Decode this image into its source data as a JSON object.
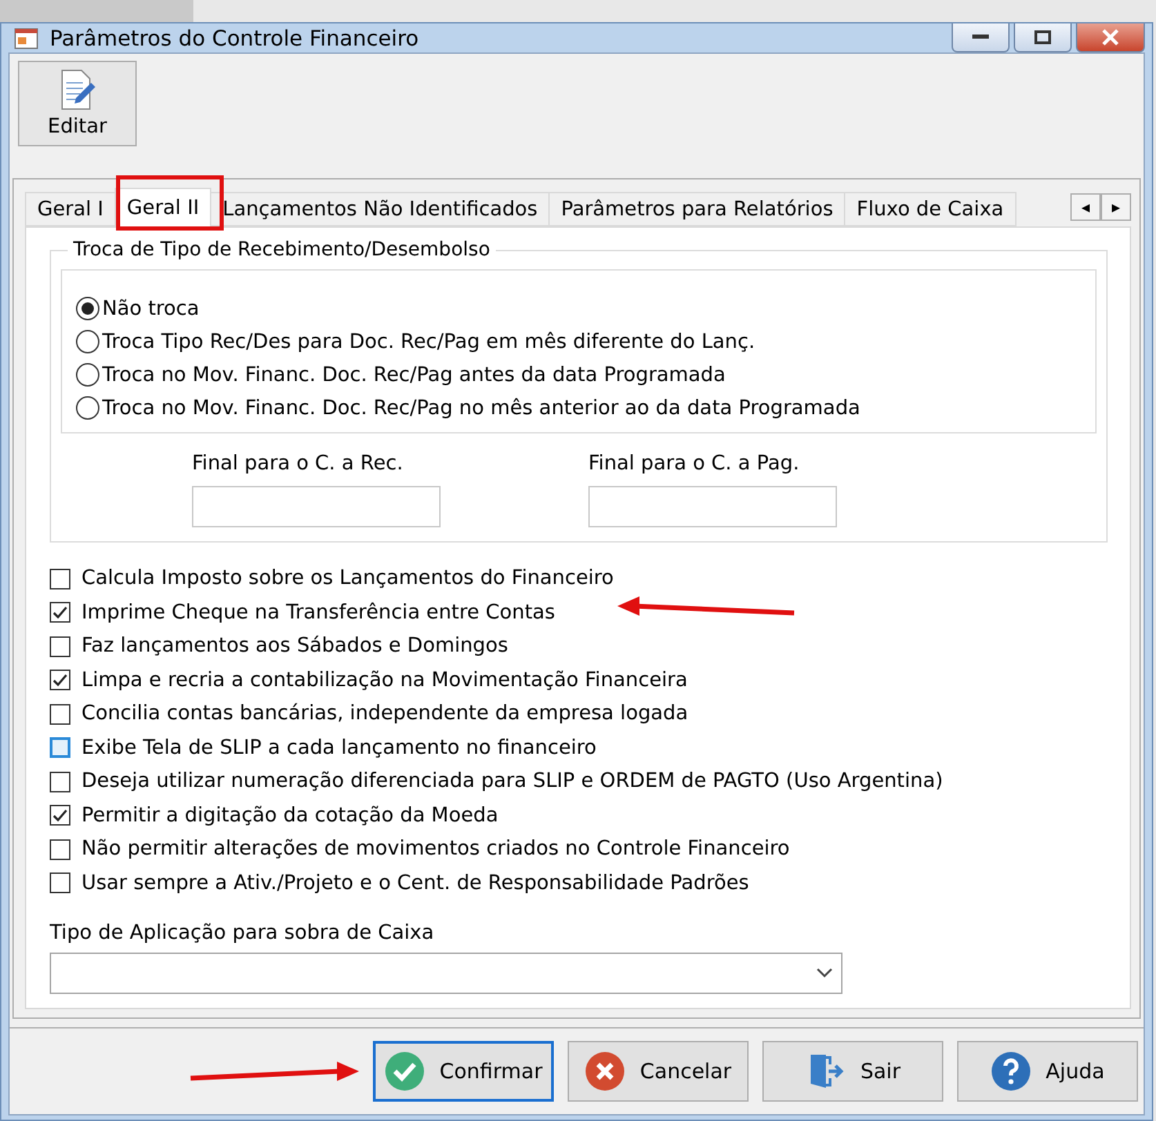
{
  "window": {
    "title": "Parâmetros do Controle Financeiro"
  },
  "toolbar": [
    {
      "label": "Editar"
    }
  ],
  "tabs": [
    {
      "label": "Geral I",
      "selected": false
    },
    {
      "label": "Geral II",
      "selected": true
    },
    {
      "label": "Lançamentos Não Identificados",
      "selected": false
    },
    {
      "label": "Parâmetros para Relatórios",
      "selected": false
    },
    {
      "label": "Fluxo de Caixa",
      "selected": false
    }
  ],
  "tab_scroll": [
    "◂",
    "▸"
  ],
  "group": {
    "title": "Troca de Tipo de Recebimento/Desembolso",
    "options": [
      {
        "label": "Não troca",
        "selected": true
      },
      {
        "label": "Troca Tipo Rec/Des para Doc. Rec/Pag em mês diferente do Lanç.",
        "selected": false
      },
      {
        "label": "Troca no Mov. Financ. Doc. Rec/Pag antes da data Programada",
        "selected": false
      },
      {
        "label": "Troca no Mov. Financ. Doc. Rec/Pag no mês anterior ao da data Programada",
        "selected": false
      }
    ],
    "fields": [
      {
        "label": "Final para o C. a Rec."
      },
      {
        "label": "Final para o C. a Pag."
      }
    ]
  },
  "checkboxes": [
    {
      "label": "Calcula Imposto sobre os Lançamentos do Financeiro",
      "checked": false,
      "focused": false
    },
    {
      "label": "Imprime Cheque na Transferência entre Contas",
      "checked": true,
      "focused": false
    },
    {
      "label": "Faz lançamentos aos Sábados e Domingos",
      "checked": false,
      "focused": false
    },
    {
      "label": "Limpa e recria a contabilização na Movimentação Financeira",
      "checked": true,
      "focused": false
    },
    {
      "label": "Concilia contas bancárias, independente da empresa logada",
      "checked": false,
      "focused": false
    },
    {
      "label": "Exibe Tela de SLIP a cada lançamento no financeiro",
      "checked": false,
      "focused": true
    },
    {
      "label": "Deseja utilizar numeração diferenciada para SLIP e ORDEM de PAGTO (Uso Argentina)",
      "checked": false,
      "focused": false
    },
    {
      "label": "Permitir a digitação da cotação da Moeda",
      "checked": true,
      "focused": false
    },
    {
      "label": "Não permitir alterações de movimentos criados no Controle Financeiro",
      "checked": false,
      "focused": false
    },
    {
      "label": "Usar sempre a Ativ./Projeto e o Cent. de Responsabilidade Padrões",
      "checked": false,
      "focused": false
    }
  ],
  "dropdown": {
    "label": "Tipo de Aplicação para sobra de Caixa"
  },
  "buttons": [
    {
      "label": "Confirmar",
      "kind": "confirm",
      "focused": true
    },
    {
      "label": "Cancelar",
      "kind": "cancel",
      "focused": false
    },
    {
      "label": "Sair",
      "kind": "exit",
      "focused": false
    },
    {
      "label": "Ajuda",
      "kind": "help",
      "focused": false
    }
  ]
}
